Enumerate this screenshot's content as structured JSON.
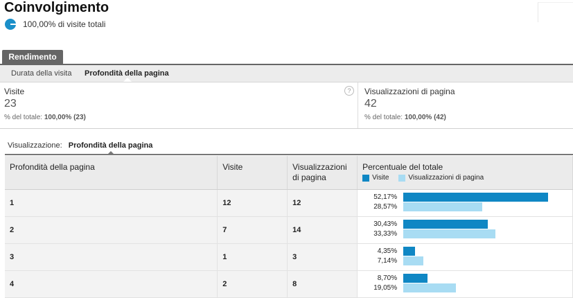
{
  "page": {
    "title": "Coinvolgimento",
    "segment_label": "100,00% di visite totali"
  },
  "colors": {
    "visits": "#0f87c4",
    "pageviews": "#a8dcf3",
    "tab": "#666666"
  },
  "tabs": {
    "main_label": "Rendimento",
    "sub": [
      {
        "label": "Durata della visita"
      },
      {
        "label": "Profondità della pagina"
      }
    ]
  },
  "metrics": [
    {
      "label": "Visite",
      "value": "23",
      "pct_prefix": "% del totale:",
      "pct_value": "100,00% (23)"
    },
    {
      "label": "Visualizzazioni di pagina",
      "value": "42",
      "pct_prefix": "% del totale:",
      "pct_value": "100,00% (42)"
    }
  ],
  "help_icon": "?",
  "view": {
    "label": "Visualizzazione:",
    "value": "Profondità della pagina"
  },
  "table": {
    "headers": {
      "depth": "Profondità della pagina",
      "visits": "Visite",
      "pageviews": "Visualizzazioni di pagina",
      "percent": "Percentuale del totale",
      "legend_visits": "Visite",
      "legend_pageviews": "Visualizzazioni di pagina"
    },
    "rows": [
      {
        "depth": "1",
        "visits": "12",
        "pageviews": "12",
        "visits_pct": "52,17%",
        "pageviews_pct": "28,57%",
        "visits_frac": 0.5217,
        "pageviews_frac": 0.2857
      },
      {
        "depth": "2",
        "visits": "7",
        "pageviews": "14",
        "visits_pct": "30,43%",
        "pageviews_pct": "33,33%",
        "visits_frac": 0.3043,
        "pageviews_frac": 0.3333
      },
      {
        "depth": "3",
        "visits": "1",
        "pageviews": "3",
        "visits_pct": "4,35%",
        "pageviews_pct": "7,14%",
        "visits_frac": 0.0435,
        "pageviews_frac": 0.0714
      },
      {
        "depth": "4",
        "visits": "2",
        "pageviews": "8",
        "visits_pct": "8,70%",
        "pageviews_pct": "19,05%",
        "visits_frac": 0.087,
        "pageviews_frac": 0.1905
      }
    ]
  }
}
